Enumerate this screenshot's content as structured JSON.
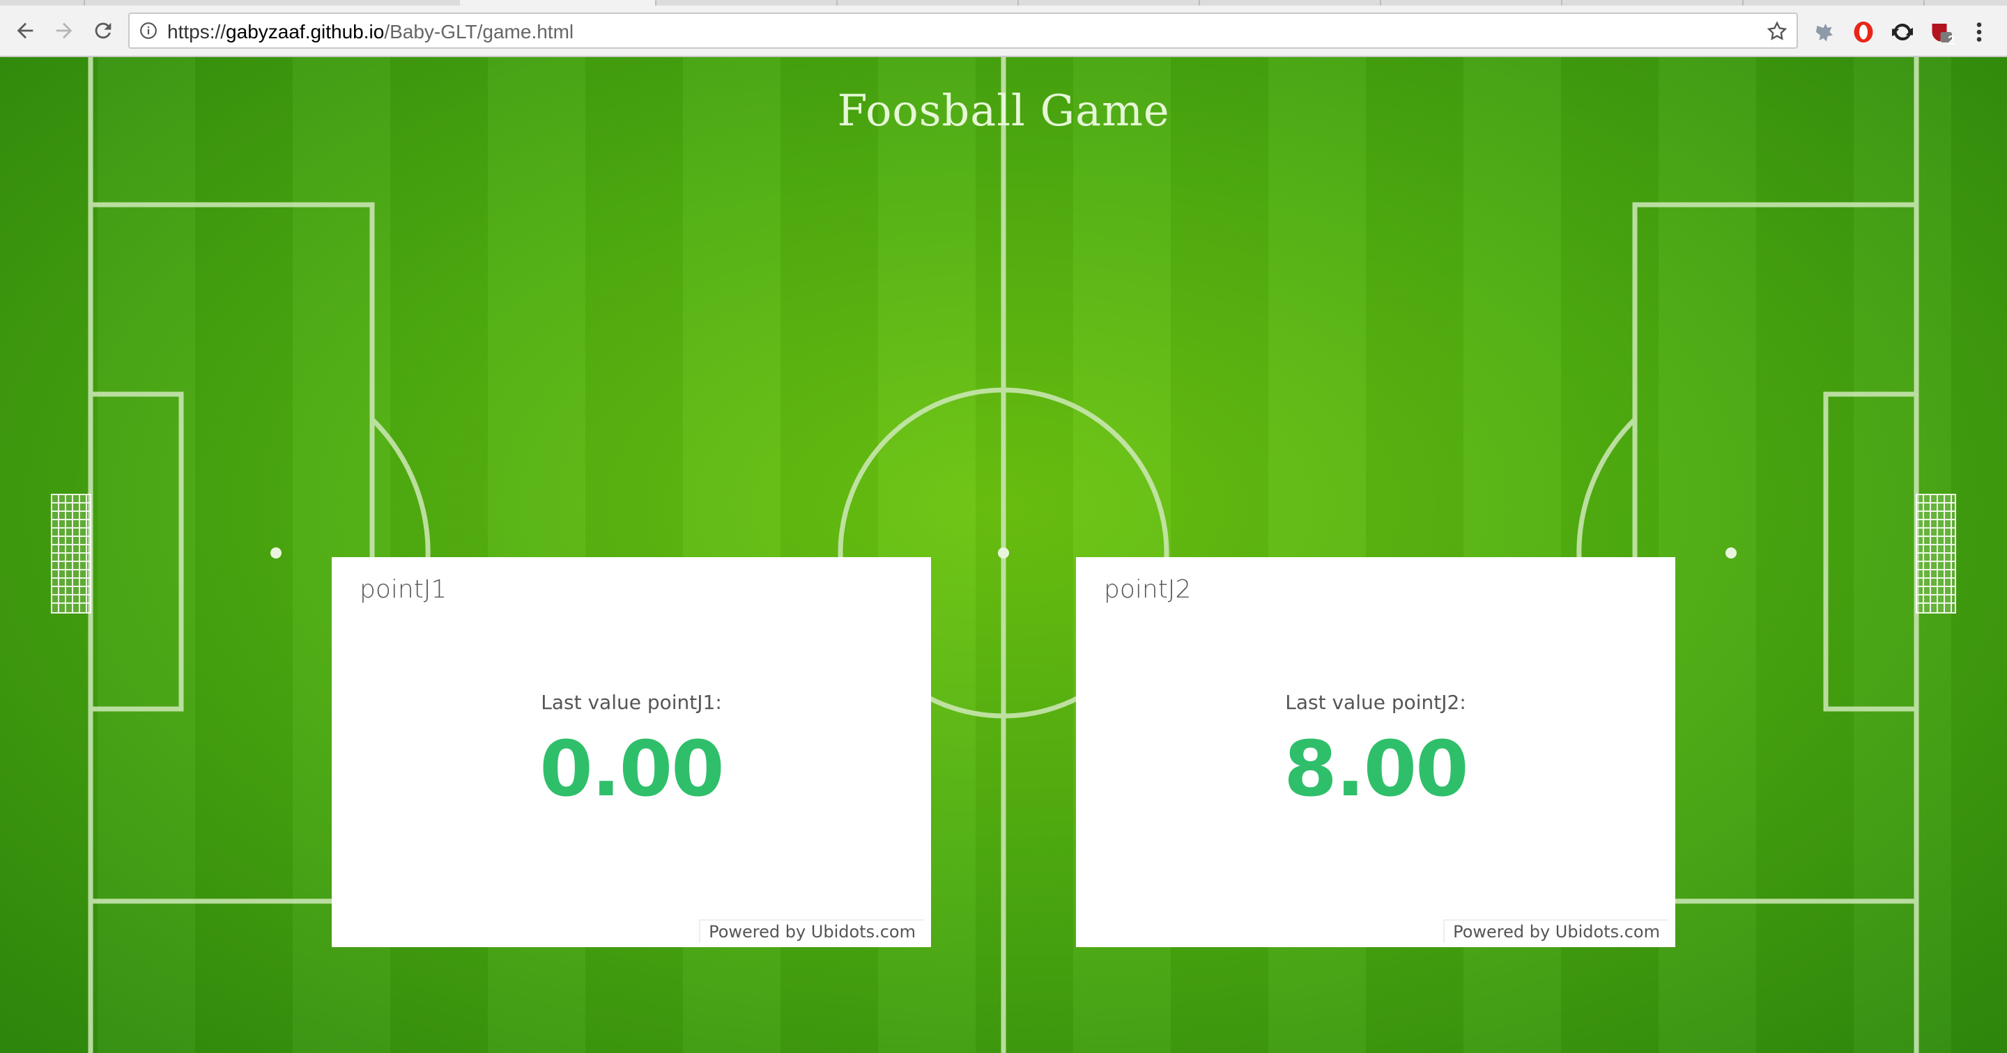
{
  "browser": {
    "url_scheme": "https://",
    "url_host": "gabyzaaf.github.io",
    "url_path": "/Baby-GLT/game.html",
    "icons": {
      "back": "back-arrow-icon",
      "forward": "forward-arrow-icon",
      "reload": "reload-icon",
      "info": "info-icon",
      "bookmark": "star-icon",
      "extensions": [
        "puzzle-extension-icon",
        "opera-o-icon",
        "sync-icon",
        "shield-badge-icon",
        "menu-dots-icon"
      ]
    },
    "extension_badge": "2"
  },
  "page": {
    "title": "Foosball Game",
    "field_color": "#4fae10"
  },
  "widgets": [
    {
      "title": "pointJ1",
      "caption": "Last value pointJ1:",
      "value": "0.00",
      "powered": "Powered by Ubidots.com",
      "value_color": "#2fbf6a"
    },
    {
      "title": "pointJ2",
      "caption": "Last value pointJ2:",
      "value": "8.00",
      "powered": "Powered by Ubidots.com",
      "value_color": "#2fbf6a"
    }
  ]
}
